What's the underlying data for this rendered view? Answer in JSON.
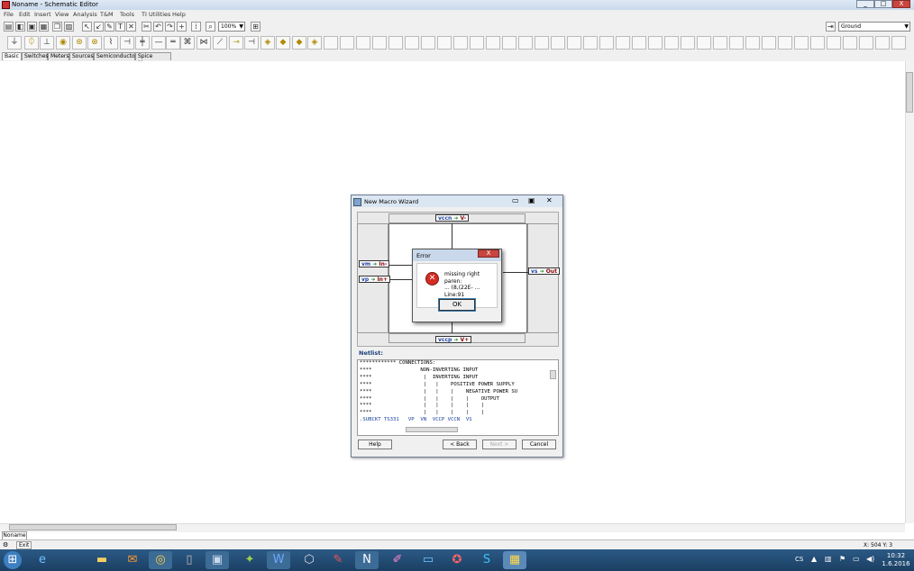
{
  "window": {
    "title": "Noname - Schematic Editor",
    "min": "_",
    "max": "□",
    "close": "X"
  },
  "menu": [
    "File",
    "Edit",
    "Insert",
    "View",
    "Analysis",
    "T&M",
    "Tools",
    "TI Utilities",
    "Help"
  ],
  "toolbar": {
    "zoom": "100%",
    "component_select": "Ground"
  },
  "tabs": [
    "Basic",
    "Switches",
    "Meters",
    "Sources",
    "Semiconductors",
    "Spice Macros"
  ],
  "document_tab": "Noname",
  "status": {
    "exit_label": "Exit",
    "coords": "X: 504  Y: 3"
  },
  "taskbar": {
    "language": "CS",
    "time": "10:32",
    "date": "1.6.2016"
  },
  "wizard": {
    "title": "New Macro Wizard",
    "pins": {
      "top": {
        "node": "vccn",
        "label": "V-"
      },
      "left1": {
        "node": "vm",
        "label": "In-"
      },
      "left2": {
        "node": "vp",
        "label": "In+"
      },
      "right": {
        "node": "vs",
        "label": "Out"
      },
      "bottom": {
        "node": "vccp",
        "label": "V+"
      }
    },
    "netlist_label": "Netlist:",
    "netlist_lines": [
      "************ CONNECTIONS:",
      "****                NON-INVERTING INPUT",
      "****                 |  INVERTING INPUT",
      "****                 |   |    POSITIVE POWER SUPPLY",
      "****                 |   |    |    NEGATIVE POWER SU",
      "****                 |   |    |    |    OUTPUT",
      "****                 |   |    |    |    |",
      "****                 |   |    |    |    |",
      ".SUBCKT TS331   VP  VN  VCCP VCCN  VS"
    ],
    "buttons": {
      "help": "Help",
      "back": "< Back",
      "next": "Next >",
      "cancel": "Cancel"
    }
  },
  "error": {
    "title": "Error",
    "close": "X",
    "message_line1": "missing right paren:",
    "message_line2": "... (8,(22E- ...",
    "message_line3": "Line:91",
    "ok": "OK"
  },
  "colors": {
    "error_red": "#d42c22",
    "taskbar": "#1c3f63",
    "node_blue": "#1a3f9a"
  }
}
